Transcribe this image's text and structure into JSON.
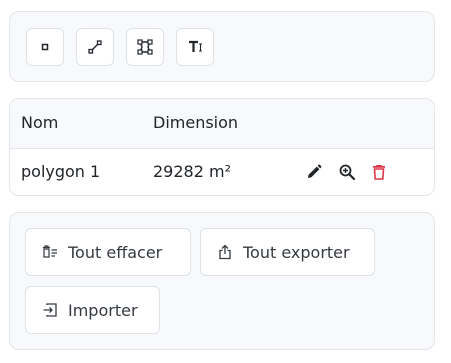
{
  "toolbar": {
    "tools": [
      {
        "name": "point-tool",
        "icon": "square-dot-icon"
      },
      {
        "name": "line-tool",
        "icon": "line-segment-icon"
      },
      {
        "name": "polygon-tool",
        "icon": "polygon-vertices-icon"
      },
      {
        "name": "text-tool",
        "icon": "text-insert-icon"
      }
    ]
  },
  "table": {
    "headers": {
      "name": "Nom",
      "dimension": "Dimension"
    },
    "rows": [
      {
        "name": "polygon 1",
        "dimension": "29282 m²"
      }
    ]
  },
  "actions": {
    "clear_all": "Tout effacer",
    "export_all": "Tout exporter",
    "import": "Importer"
  },
  "colors": {
    "delete": "#dc3545",
    "icon": "#212529",
    "panel_border": "#e3e5ea"
  }
}
